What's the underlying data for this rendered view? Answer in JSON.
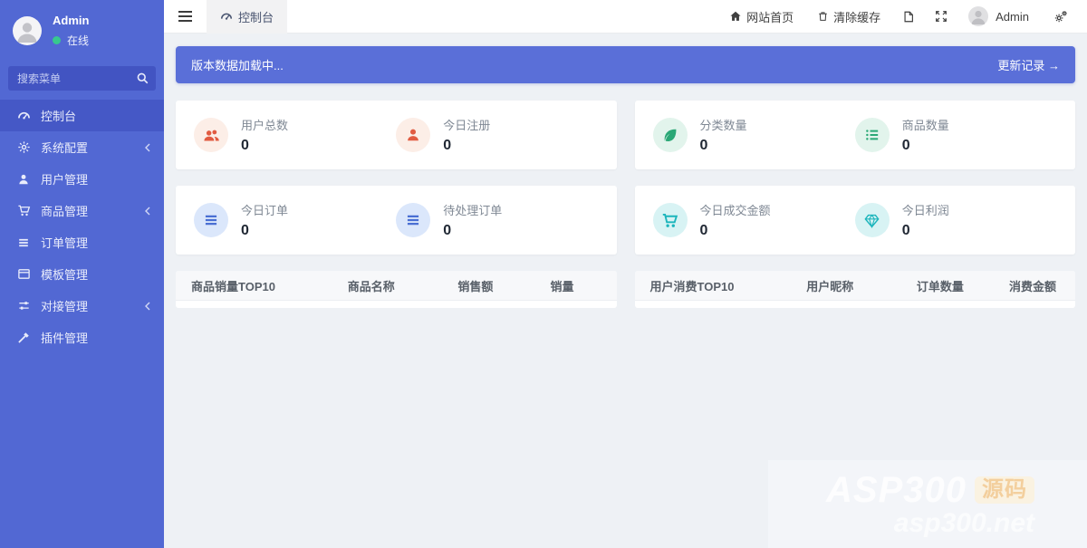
{
  "sidebar": {
    "user": {
      "name": "Admin",
      "status": "在线"
    },
    "search_placeholder": "搜索菜单",
    "items": [
      {
        "label": "控制台",
        "icon": "tachometer-icon",
        "active": true,
        "has_submenu": false
      },
      {
        "label": "系统配置",
        "icon": "gear-icon",
        "active": false,
        "has_submenu": true
      },
      {
        "label": "用户管理",
        "icon": "user-icon",
        "active": false,
        "has_submenu": false
      },
      {
        "label": "商品管理",
        "icon": "cart-icon",
        "active": false,
        "has_submenu": true
      },
      {
        "label": "订单管理",
        "icon": "list-icon",
        "active": false,
        "has_submenu": false
      },
      {
        "label": "模板管理",
        "icon": "template-icon",
        "active": false,
        "has_submenu": false
      },
      {
        "label": "对接管理",
        "icon": "sliders-icon",
        "active": false,
        "has_submenu": true
      },
      {
        "label": "插件管理",
        "icon": "brush-icon",
        "active": false,
        "has_submenu": false
      }
    ]
  },
  "navbar": {
    "tab": {
      "label": "控制台",
      "icon": "tachometer-icon"
    },
    "links": [
      {
        "label": "网站首页",
        "icon": "home-icon"
      },
      {
        "label": "清除缓存",
        "icon": "trash-icon"
      }
    ],
    "icon_buttons": [
      "page-icon",
      "expand-icon"
    ],
    "user_name": "Admin"
  },
  "banner": {
    "text": "版本数据加载中...",
    "link": "更新记录 →"
  },
  "stats": [
    {
      "label": "用户总数",
      "value": "0",
      "icon": "users-icon",
      "color": "red"
    },
    {
      "label": "今日注册",
      "value": "0",
      "icon": "user-icon",
      "color": "red"
    },
    {
      "label": "分类数量",
      "value": "0",
      "icon": "leaf-icon",
      "color": "green"
    },
    {
      "label": "商品数量",
      "value": "0",
      "icon": "list-ul-icon",
      "color": "green"
    },
    {
      "label": "今日订单",
      "value": "0",
      "icon": "bars-icon",
      "color": "blue"
    },
    {
      "label": "待处理订单",
      "value": "0",
      "icon": "bars-icon",
      "color": "blue"
    },
    {
      "label": "今日成交金额",
      "value": "0",
      "icon": "cart-icon",
      "color": "teal"
    },
    {
      "label": "今日利润",
      "value": "0",
      "icon": "gem-icon",
      "color": "teal"
    }
  ],
  "tables": [
    {
      "title": "商品销量TOP10",
      "columns": [
        "商品名称",
        "销售额",
        "销量"
      ],
      "rows": []
    },
    {
      "title": "用户消费TOP10",
      "columns": [
        "用户昵称",
        "订单数量",
        "消费金额"
      ],
      "rows": []
    }
  ],
  "watermark": {
    "line1": "ASP300",
    "badge": "源码",
    "line2": "asp300.net"
  },
  "colors": {
    "sidebar_bg": "#5268d3",
    "sidebar_active_bg": "#4558c6",
    "search_bg": "#4254c2",
    "banner_bg": "#5a6fd8",
    "content_bg": "#eef1f5",
    "online_dot": "#37c98e",
    "stat_red": "#e15b41",
    "stat_green": "#2aa876",
    "stat_blue": "#4a6fd3",
    "stat_teal": "#1cb5bc"
  }
}
